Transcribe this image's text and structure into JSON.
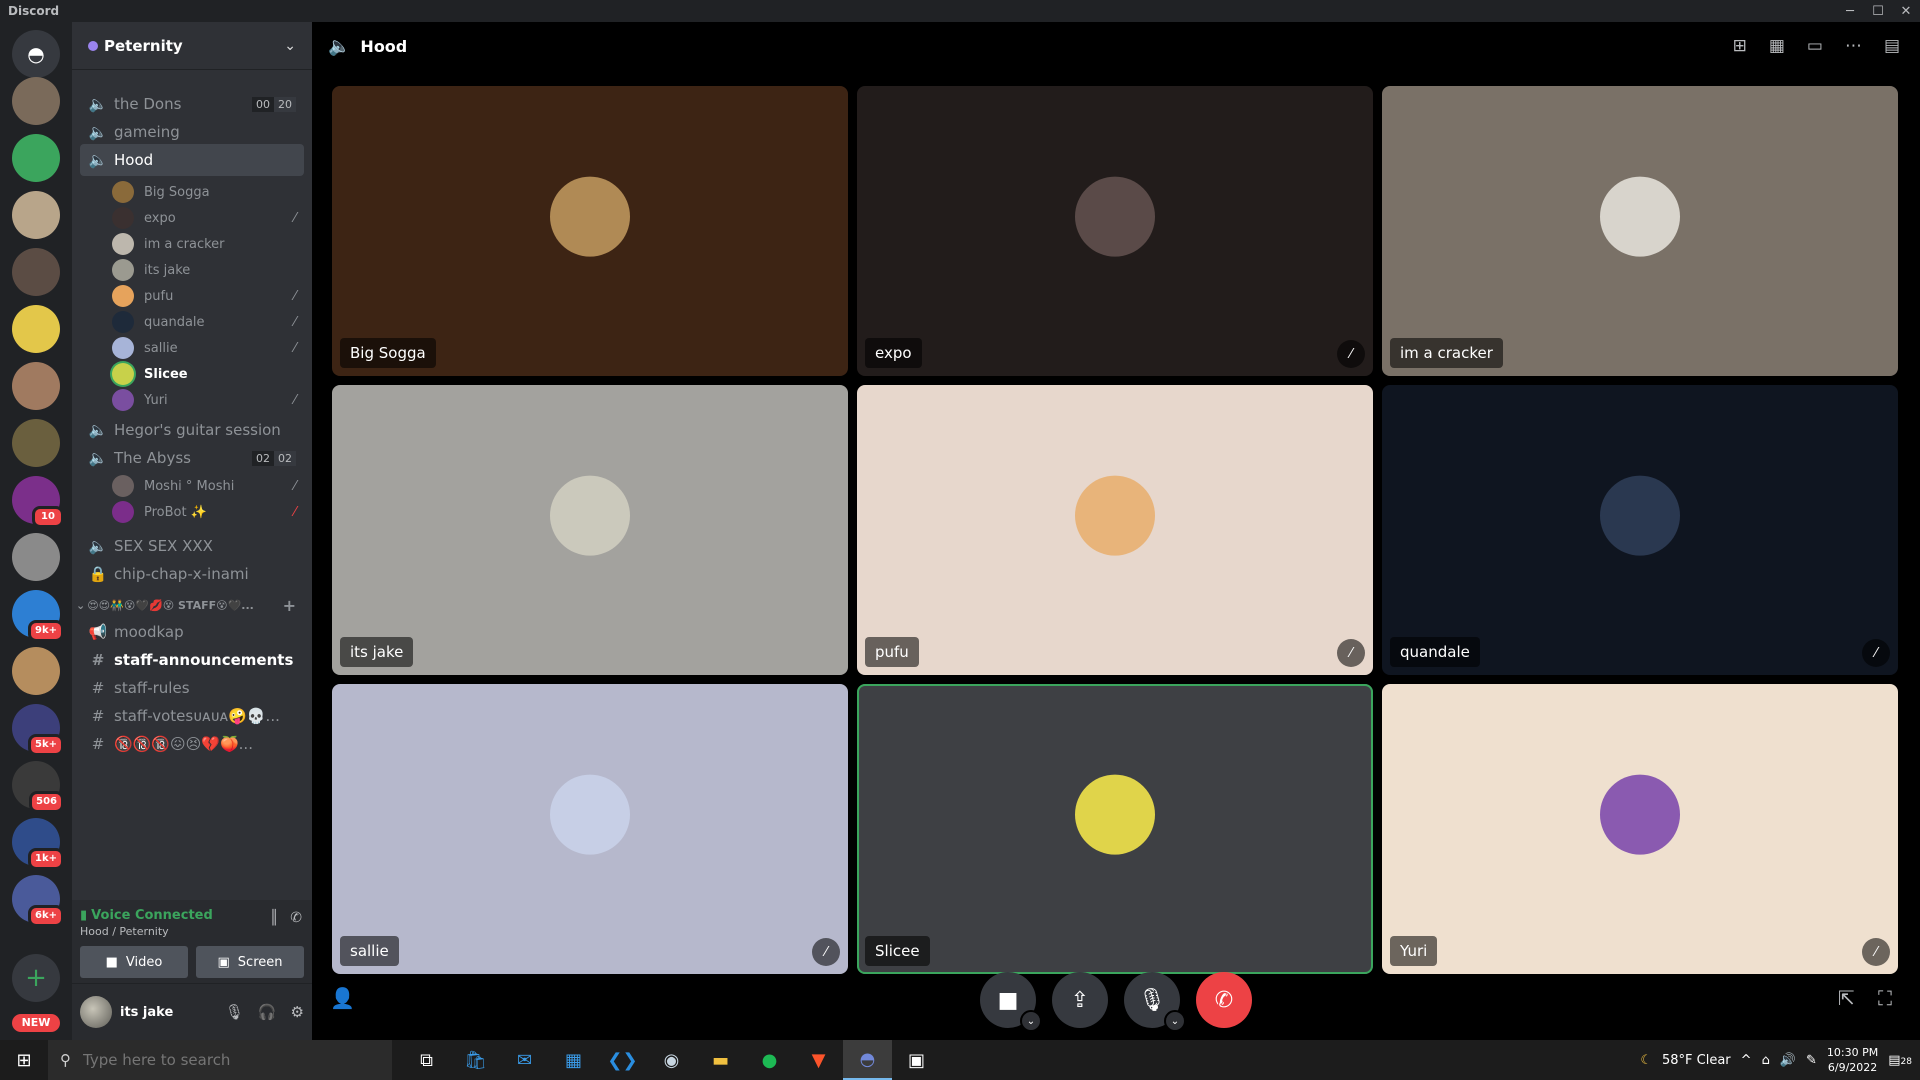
{
  "window": {
    "app_name": "Discord"
  },
  "rail": {
    "servers": [
      {
        "color": "#7a6a5a",
        "badge": ""
      },
      {
        "color": "#3ba55d",
        "badge": ""
      },
      {
        "color": "#b8a58a",
        "badge": ""
      },
      {
        "color": "#5b4c44",
        "badge": ""
      },
      {
        "color": "#e3c74a",
        "badge": ""
      },
      {
        "color": "#a07a60",
        "badge": ""
      },
      {
        "color": "#6a5f3e",
        "badge": ""
      },
      {
        "color": "#7b2f8a",
        "badge": "10"
      },
      {
        "color": "#8a8a8a",
        "badge": ""
      },
      {
        "color": "#2d7fd3",
        "badge": "9k+"
      },
      {
        "color": "#b58d5e",
        "badge": ""
      },
      {
        "color": "#3c3f7a",
        "badge": "5k+"
      },
      {
        "color": "#3a3a3a",
        "badge": "506"
      },
      {
        "color": "#2f4c8a",
        "badge": "1k+"
      },
      {
        "color": "#4a5a9a",
        "badge": "6k+"
      }
    ],
    "new_label": "NEW"
  },
  "guild": {
    "name": "Peternity"
  },
  "channels": {
    "the_dons": "the Dons",
    "the_dons_limit": [
      "00",
      "20"
    ],
    "gameing": "gameing",
    "hood": "Hood",
    "hegor": "Hegor's guitar session",
    "abyss": "The Abyss",
    "abyss_limit": [
      "02",
      "02"
    ],
    "sex": "SEX SEX XXX",
    "chip": "chip-chap-x-inami",
    "category": "😍😍👬😵🖤💋😵 STAFF😵🖤...",
    "moodkap": "moodkap",
    "staff_ann": "staff-announcements",
    "staff_rules": "staff-rules",
    "staff_votes": "staff-votesᴜᴀᴜᴀ🤪💀...",
    "last": "🔞🔞🔞😖😣💔🍑..."
  },
  "hood_users": [
    {
      "name": "Big Sogga",
      "muted": false,
      "speaking": false,
      "color": "#8a6a3a"
    },
    {
      "name": "expo",
      "muted": true,
      "speaking": false,
      "color": "#3a3030"
    },
    {
      "name": "im a cracker",
      "muted": false,
      "speaking": false,
      "color": "#bdb7ad"
    },
    {
      "name": "its jake",
      "muted": false,
      "speaking": false,
      "color": "#9b9a90"
    },
    {
      "name": "pufu",
      "muted": true,
      "speaking": false,
      "color": "#e6a35c"
    },
    {
      "name": "quandale",
      "muted": true,
      "speaking": false,
      "color": "#1e2a3a"
    },
    {
      "name": "sallie",
      "muted": true,
      "speaking": false,
      "color": "#a7b4d8"
    },
    {
      "name": "Slicee",
      "muted": false,
      "speaking": true,
      "color": "#c8d14a"
    },
    {
      "name": "Yuri",
      "muted": true,
      "speaking": false,
      "color": "#7a4ea0"
    }
  ],
  "abyss_users": [
    {
      "name": "Moshi ° Moshi",
      "muted": true,
      "color": "#6a6060"
    },
    {
      "name": "ProBot ✨",
      "muted": true,
      "color": "#7b2d8a"
    }
  ],
  "voice_panel": {
    "status": "Voice Connected",
    "location": "Hood / Peternity",
    "video": "Video",
    "screen": "Screen"
  },
  "user": {
    "name": "its jake"
  },
  "call": {
    "title": "Hood",
    "tiles": [
      {
        "name": "Big Sogga",
        "bg": "#3d2414",
        "pic": "#b08a55",
        "muted": false,
        "speaking": false
      },
      {
        "name": "expo",
        "bg": "#221c1b",
        "pic": "#5a4a48",
        "muted": true,
        "speaking": false
      },
      {
        "name": "im a cracker",
        "bg": "#7a7167",
        "pic": "#d8d4cc",
        "muted": false,
        "speaking": false
      },
      {
        "name": "its jake",
        "bg": "#a3a29e",
        "pic": "#cbc9bc",
        "muted": false,
        "speaking": false
      },
      {
        "name": "pufu",
        "bg": "#e7d7cc",
        "pic": "#e8b47a",
        "muted": true,
        "speaking": false
      },
      {
        "name": "quandale",
        "bg": "#0f1520",
        "pic": "#2a3850",
        "muted": true,
        "speaking": false
      },
      {
        "name": "sallie",
        "bg": "#b6b8cc",
        "pic": "#c7cfe6",
        "muted": true,
        "speaking": false
      },
      {
        "name": "Slicee",
        "bg": "#3e4044",
        "pic": "#e0d44a",
        "muted": false,
        "speaking": true
      },
      {
        "name": "Yuri",
        "bg": "#efe0cf",
        "pic": "#8a5ab0",
        "muted": true,
        "speaking": false
      }
    ]
  },
  "taskbar": {
    "search_placeholder": "Type here to search",
    "weather": "58°F  Clear",
    "time": "10:30 PM",
    "date": "6/9/2022",
    "notifications": "28"
  }
}
